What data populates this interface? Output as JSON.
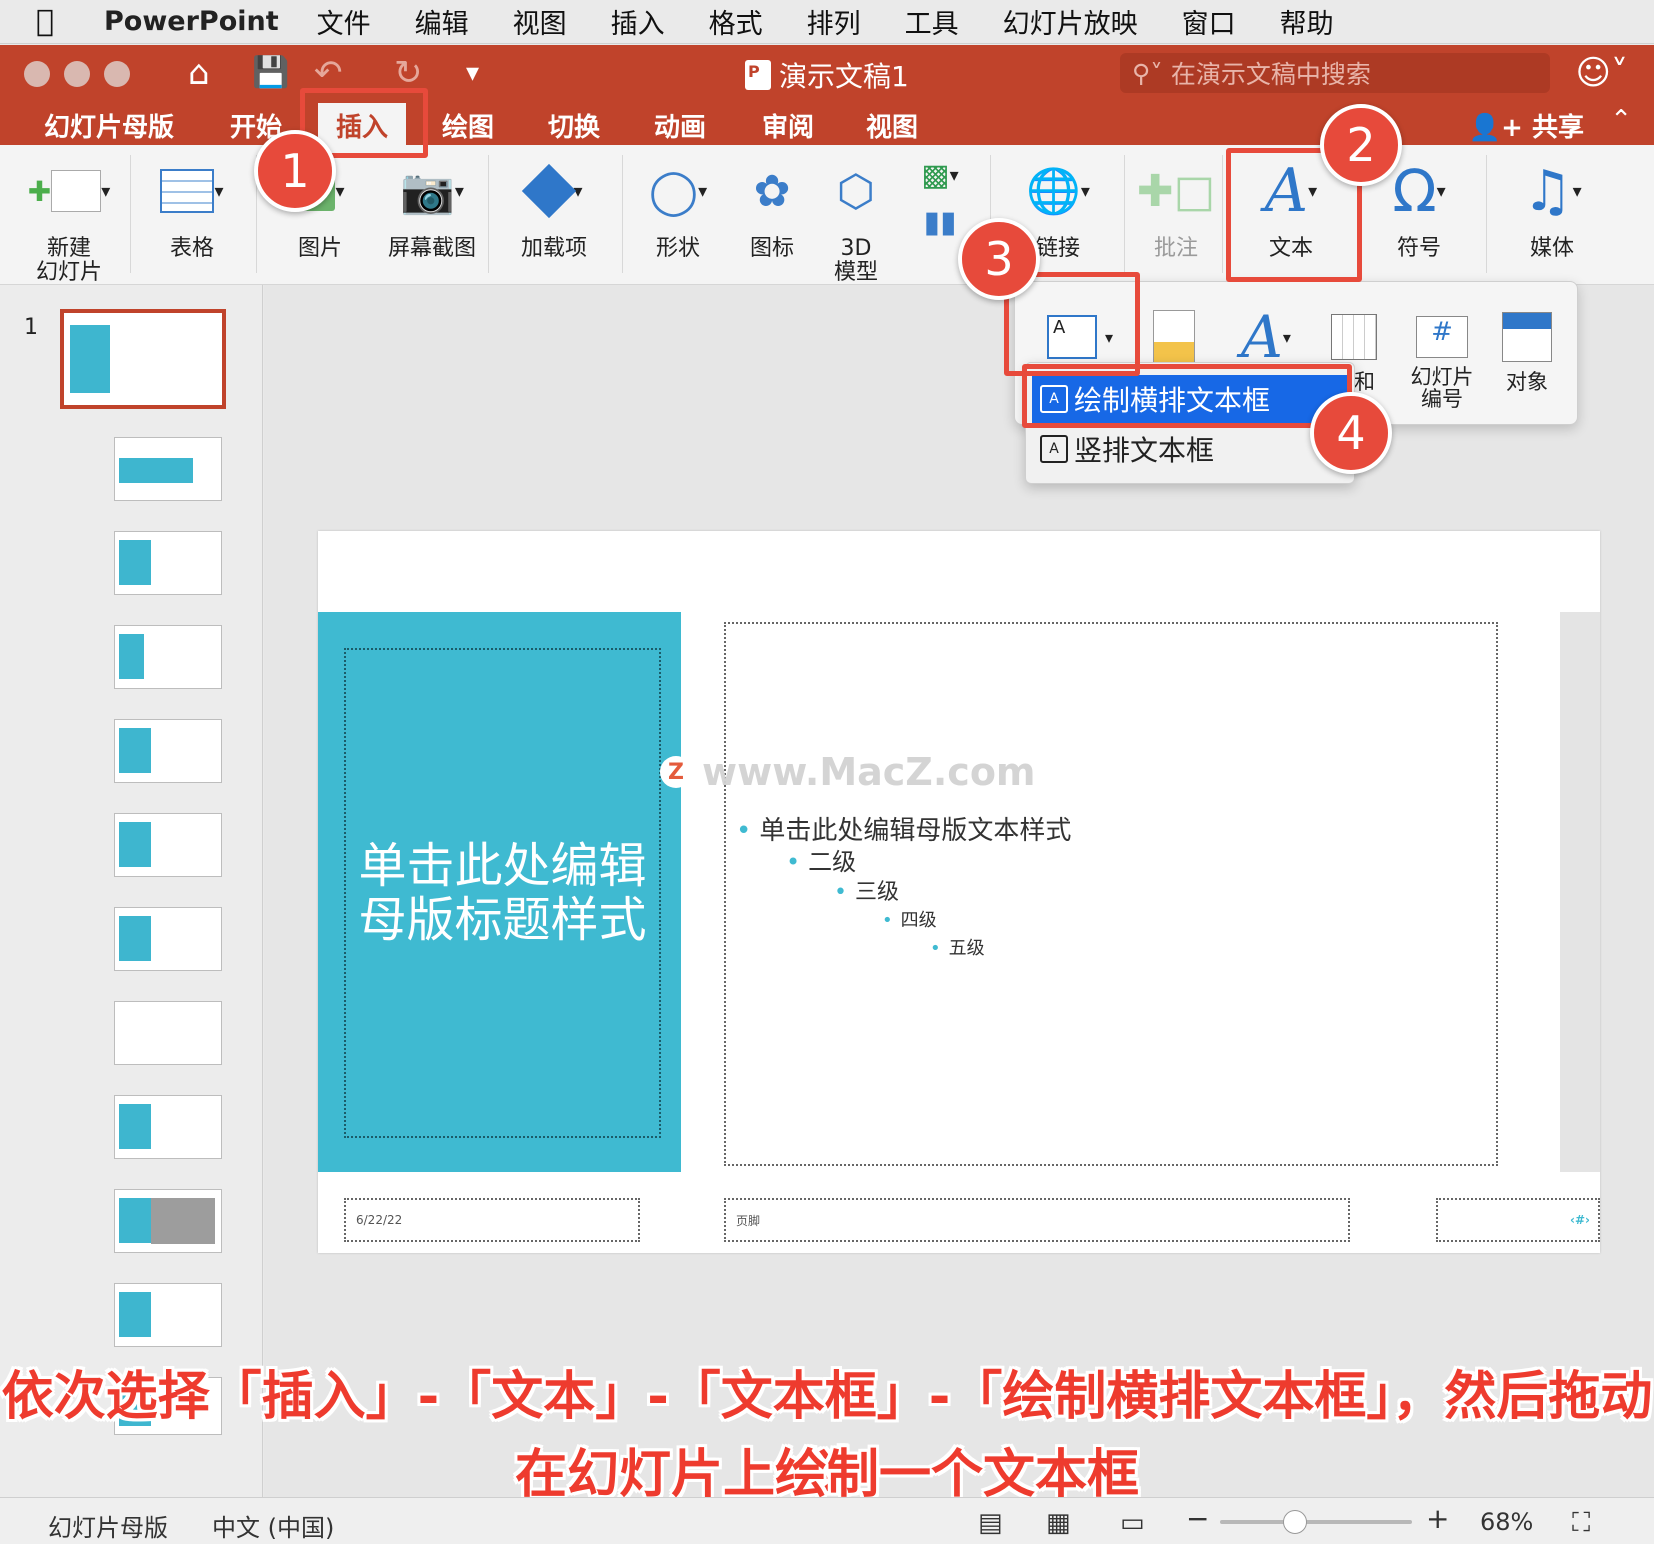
{
  "menubar": {
    "app_name": "PowerPoint",
    "items": [
      "文件",
      "编辑",
      "视图",
      "插入",
      "格式",
      "排列",
      "工具",
      "幻灯片放映",
      "窗口",
      "帮助"
    ]
  },
  "titlebar": {
    "doc_title": "演示文稿1",
    "search_placeholder": "在演示文稿中搜索"
  },
  "ribbon_tabs": {
    "items": [
      "幻灯片母版",
      "开始",
      "插入",
      "绘图",
      "切换",
      "动画",
      "审阅",
      "视图"
    ],
    "active": "插入",
    "share_label": "共享"
  },
  "ribbon": {
    "new_slide": "新建\n幻灯片",
    "table": "表格",
    "picture": "图片",
    "screenshot": "屏幕截图",
    "addins": "加载项",
    "shapes": "形状",
    "icons": "图标",
    "model3d": "3D\n模型",
    "link": "链接",
    "comment": "批注",
    "text": "文本",
    "symbol": "符号",
    "media": "媒体"
  },
  "text_popover": {
    "date_time_partial": "期和",
    "slide_number": "幻灯片\n编号",
    "object": "对象"
  },
  "submenu": {
    "horizontal": "绘制横排文本框",
    "vertical": "竖排文本框"
  },
  "slide": {
    "title": "单击此处编辑\n母版标题样式",
    "levels": [
      "单击此处编辑母版文本样式",
      "二级",
      "三级",
      "四级",
      "五级"
    ],
    "date": "6/22/22",
    "footer": "页脚",
    "number": "‹#›"
  },
  "thumbnails": {
    "first_number": "1",
    "count": 12
  },
  "watermark": "www.MacZ.com",
  "callouts": [
    "1",
    "2",
    "3",
    "4"
  ],
  "caption": {
    "line1": "依次选择「插入」-「文本」-「文本框」-「绘制横排文本框」，然后拖动以",
    "line2": "在幻灯片上绘制一个文本框"
  },
  "statusbar": {
    "view_name": "幻灯片母版",
    "language": "中文 (中国)",
    "zoom": "68%",
    "zoom_fraction": 0.39
  },
  "colors": {
    "accent": "#c0432b",
    "slide_teal": "#3fbad1",
    "highlight": "#1768e6",
    "callout": "#e74a3b"
  }
}
